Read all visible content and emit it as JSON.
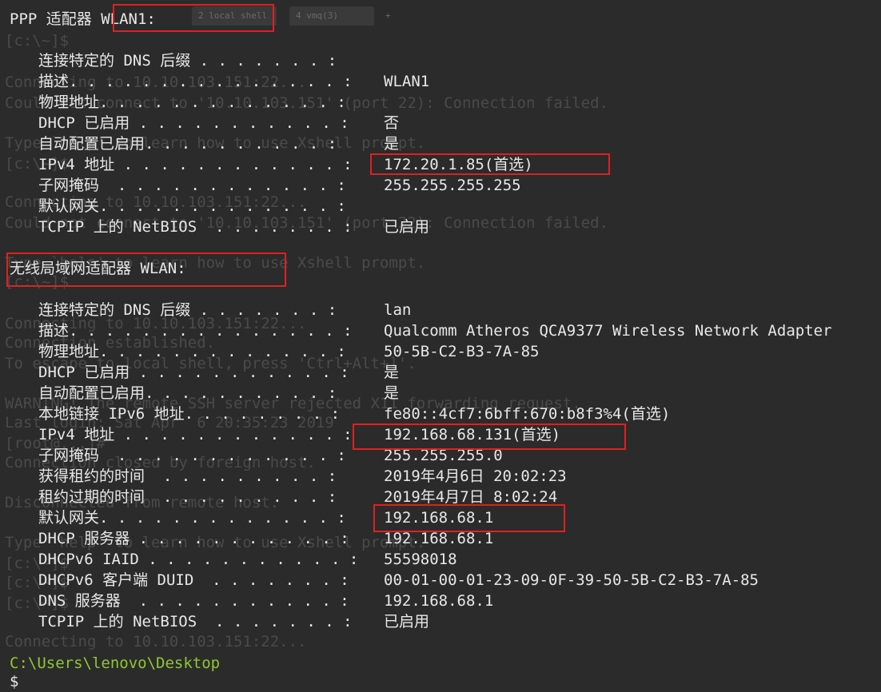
{
  "window": {
    "tabs": [
      {
        "label": "2 local shell"
      },
      {
        "label": "4 vmq(3)"
      }
    ],
    "new_tab_label": "+"
  },
  "background_history": [
    "[c:\\~]$",
    "Connecting to 10.10.103.151:22...",
    "Could not connect to '10.10.103.151' (port 22): Connection failed.",
    "Type `help' to learn how to use Xshell prompt.",
    "[c:\\~]$",
    "Connecting to 10.10.103.151:22...",
    "Could not connect to '10.10.103.151' (port 22): Connection failed.",
    "Type `help' to learn how to use Xshell prompt.",
    "[c:\\~]$",
    "Connecting to 10.10.103.151:22...",
    "Connection established.",
    "To escape to local shell, press 'Ctrl+Alt+]'.",
    "WARNING! The remote SSH server rejected X11 forwarding request.",
    "Last login: Sat Apr  6 20:35:23 2019",
    "[root@...]#",
    "Connection closed by foreign host.",
    "Disconnected from remote host.",
    "Type `help' to learn how to use Xshell prompt.",
    "[c:\\~]$",
    "[c:\\~]$",
    "[c:\\~]$",
    "Connecting to 10.10.103.151:22..."
  ],
  "adapters": [
    {
      "header": "PPP 适配器 WLAN1:",
      "rows": [
        {
          "label": "连接特定的 DNS 后缀 . . . . . . . :",
          "value": ""
        },
        {
          "label": "描述. . . . . . . . . . . . . . . :",
          "value": "WLAN1"
        },
        {
          "label": "物理地址. . . . . . . . . . . . . :",
          "value": ""
        },
        {
          "label": "DHCP 已启用 . . . . . . . . . . . :",
          "value": "否"
        },
        {
          "label": "自动配置已启用. . . . . . . . . . :",
          "value": "是"
        },
        {
          "label": "IPv4 地址 . . . . . . . . . . . . :",
          "value": "172.20.1.85(首选)"
        },
        {
          "label": "子网掩码  . . . . . . . . . . . . :",
          "value": "255.255.255.255"
        },
        {
          "label": "默认网关. . . . . . . . . . . . . :",
          "value": ""
        },
        {
          "label": "TCPIP 上的 NetBIOS  . . . . . . . :",
          "value": "已启用"
        }
      ]
    },
    {
      "header": "无线局域网适配器 WLAN:",
      "rows": [
        {
          "label": "连接特定的 DNS 后缀 . . . . . . . :",
          "value": "lan"
        },
        {
          "label": "描述. . . . . . . . . . . . . . . :",
          "value": "Qualcomm Atheros QCA9377 Wireless Network Adapter"
        },
        {
          "label": "物理地址. . . . . . . . . . . . . :",
          "value": "50-5B-C2-B3-7A-85"
        },
        {
          "label": "DHCP 已启用 . . . . . . . . . . . :",
          "value": "是"
        },
        {
          "label": "自动配置已启用. . . . . . . . . . :",
          "value": "是"
        },
        {
          "label": "本地链接 IPv6 地址. . . . . . . . :",
          "value": "fe80::4cf7:6bff:670:b8f3%4(首选)"
        },
        {
          "label": "IPv4 地址 . . . . . . . . . . . . :",
          "value": "192.168.68.131(首选)"
        },
        {
          "label": "子网掩码  . . . . . . . . . . . . :",
          "value": "255.255.255.0"
        },
        {
          "label": "获得租约的时间  . . . . . . . . . :",
          "value": "2019年4月6日 20:02:23"
        },
        {
          "label": "租约过期的时间  . . . . . . . . . :",
          "value": "2019年4月7日 8:02:24"
        },
        {
          "label": "默认网关. . . . . . . . . . . . . :",
          "value": "192.168.68.1"
        },
        {
          "label": "DHCP 服务器 . . . . . . . . . . . :",
          "value": "192.168.68.1"
        },
        {
          "label": "DHCPv6 IAID . . . . . . . . . . . :",
          "value": "55598018"
        },
        {
          "label": "DHCPv6 客户端 DUID  . . . . . . . :",
          "value": "00-01-00-01-23-09-0F-39-50-5B-C2-B3-7A-85"
        },
        {
          "label": "DNS 服务器  . . . . . . . . . . . :",
          "value": "192.168.68.1"
        },
        {
          "label": "TCPIP 上的 NetBIOS  . . . . . . . :",
          "value": "已启用"
        }
      ]
    }
  ],
  "prompt": {
    "path": "C:\\Users\\lenovo\\Desktop",
    "cursor": "$"
  },
  "colors": {
    "background": "#2b2b2b",
    "text": "#e8e8e8",
    "prompt": "#8fc832",
    "highlight_box": "#e02020",
    "ghost_text": "#4a4a4a"
  }
}
